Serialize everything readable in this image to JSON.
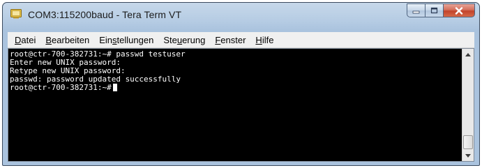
{
  "window": {
    "title": "COM3:115200baud - Tera Term VT",
    "icon": "teraterm-app-icon",
    "controls": {
      "minimize_icon": "minimize-icon",
      "maximize_icon": "maximize-icon",
      "close_icon": "close-icon"
    }
  },
  "menu": {
    "items": [
      {
        "pre": "",
        "accel": "D",
        "post": "atei"
      },
      {
        "pre": "",
        "accel": "B",
        "post": "earbeiten"
      },
      {
        "pre": "Ein",
        "accel": "s",
        "post": "tellungen"
      },
      {
        "pre": "Ste",
        "accel": "u",
        "post": "erung"
      },
      {
        "pre": "",
        "accel": "F",
        "post": "enster"
      },
      {
        "pre": "",
        "accel": "H",
        "post": "ilfe"
      }
    ]
  },
  "terminal": {
    "lines": [
      "root@ctr-700-382731:~# passwd testuser",
      "Enter new UNIX password:",
      "Retype new UNIX password:",
      "passwd: password updated successfully",
      "root@ctr-700-382731:~#"
    ],
    "colors": {
      "background": "#000000",
      "foreground": "#ffffff"
    }
  },
  "scrollbar": {
    "up_icon": "scroll-up-arrow-icon",
    "down_icon": "scroll-down-arrow-icon",
    "position": 1.0
  }
}
